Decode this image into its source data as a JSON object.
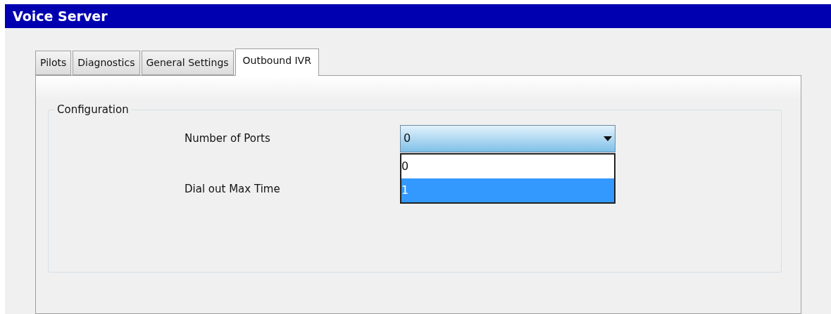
{
  "window": {
    "title": "Voice Server"
  },
  "tabs": [
    {
      "label": "Pilots",
      "selected": false
    },
    {
      "label": "Diagnostics",
      "selected": false
    },
    {
      "label": "General Settings",
      "selected": false
    },
    {
      "label": "Outbound IVR",
      "selected": true
    }
  ],
  "group": {
    "title": "Configuration",
    "fields": [
      {
        "label": "Number of Ports",
        "value": "0",
        "expanded": true,
        "options": [
          {
            "label": "0",
            "highlighted": false
          },
          {
            "label": "1",
            "highlighted": true
          }
        ]
      },
      {
        "label": "Dial out Max Time"
      }
    ]
  }
}
